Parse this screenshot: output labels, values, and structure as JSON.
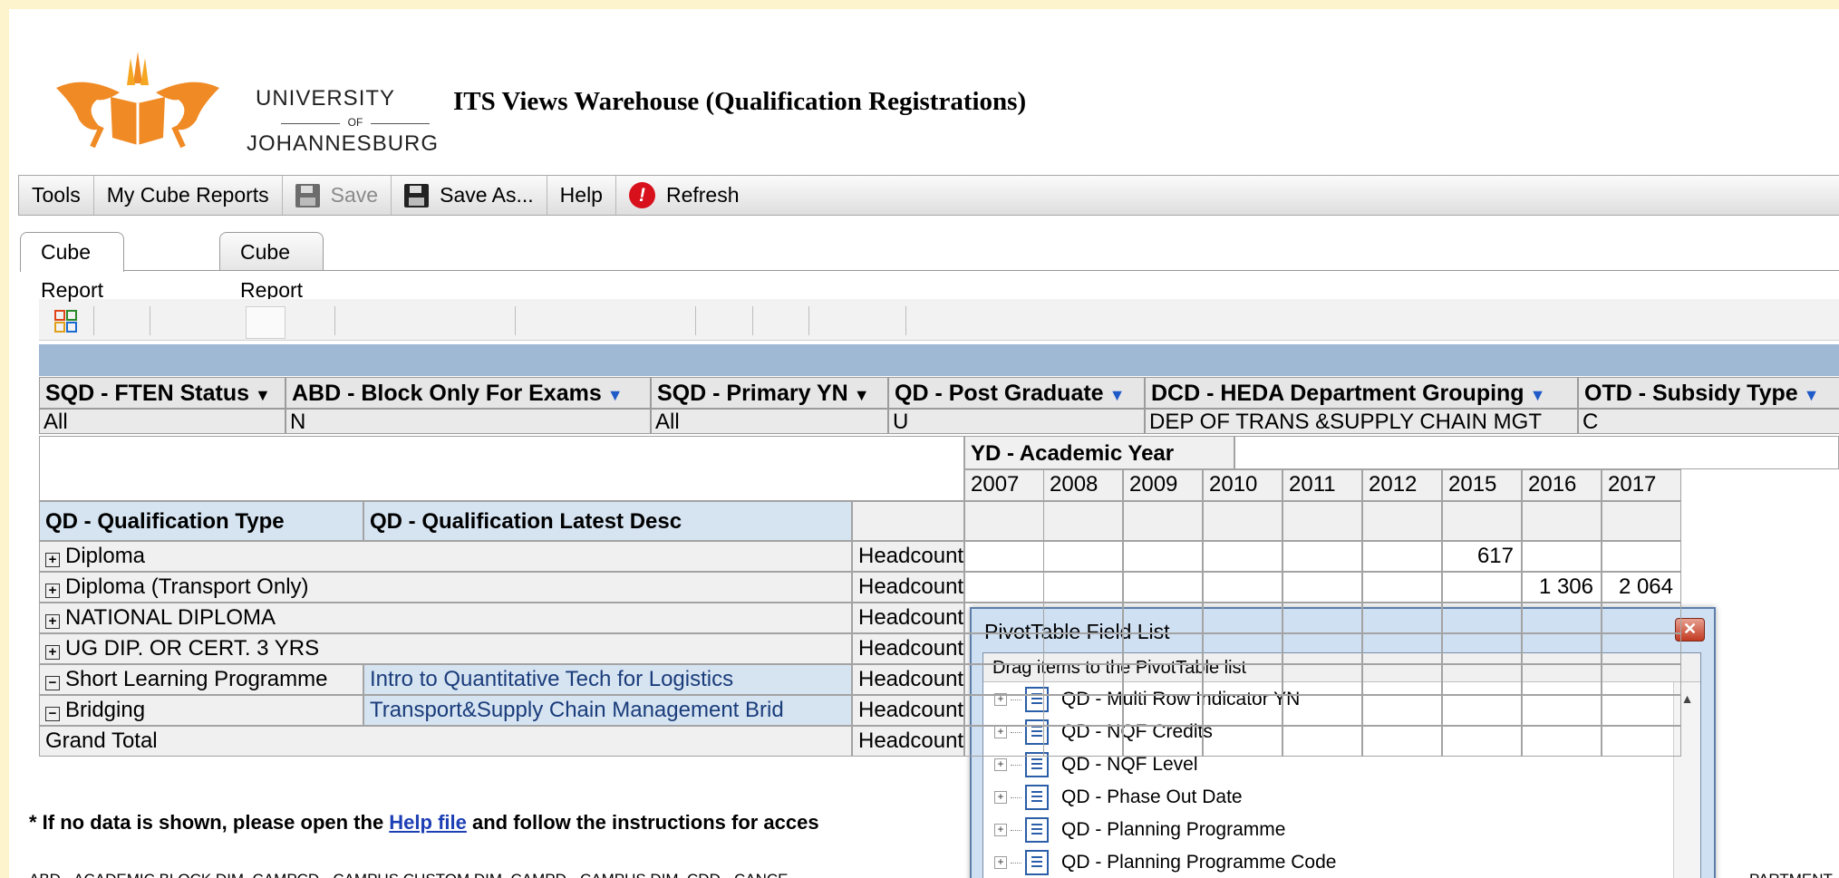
{
  "header": {
    "logo": {
      "line1": "UNIVERSITY",
      "line2": "OF",
      "line3": "JOHANNESBURG"
    },
    "title": "ITS Views Warehouse (Qualification Registrations)"
  },
  "toolbar": {
    "tools": "Tools",
    "my_reports": "My Cube Reports",
    "save": "Save",
    "save_as": "Save As...",
    "help": "Help",
    "refresh": "Refresh"
  },
  "tabs": [
    "Cube Report",
    "Cube Report Chart"
  ],
  "filters": [
    {
      "label": "SQD - FTEN Status",
      "value": "All"
    },
    {
      "label": "ABD - Block Only For Exams",
      "value": "N"
    },
    {
      "label": "SQD - Primary YN",
      "value": "All"
    },
    {
      "label": "QD - Post Graduate",
      "value": "U"
    },
    {
      "label": "DCD - HEDA Department Grouping",
      "value": "DEP OF TRANS &SUPPLY CHAIN MGT"
    },
    {
      "label": "OTD - Subsidy Type",
      "value": "C"
    }
  ],
  "pivot": {
    "col_field": "YD - Academic Year",
    "years": [
      "2007",
      "2008",
      "2009",
      "2010",
      "2011",
      "2012",
      "2015",
      "2016",
      "2017"
    ],
    "row_field1": "QD - Qualification Type",
    "row_field2": "QD - Qualification  Latest Desc",
    "expand_glyph": "⊞",
    "collapse_glyph": "⊟",
    "rows": [
      {
        "type": "Diploma",
        "desc": "",
        "measure": "Headcount",
        "values": {
          "2015": "617"
        }
      },
      {
        "type": "Diploma (Transport Only)",
        "desc": "",
        "measure": "Headcount",
        "values": {
          "2016": "1 306",
          "2017": "2 064"
        }
      },
      {
        "type": "NATIONAL DIPLOMA",
        "desc": "",
        "measure": "Headcount",
        "values": {}
      },
      {
        "type": "UG DIP. OR CERT. 3 YRS",
        "desc": "",
        "measure": "Headcount",
        "values": {}
      },
      {
        "type": "Short Learning Programme",
        "desc": "Intro to Quantitative Tech for Logistics",
        "measure": "Headcount",
        "values": {}
      },
      {
        "type": "Bridging",
        "desc": "Transport&Supply Chain Management Brid",
        "measure": "Headcount",
        "values": {}
      },
      {
        "type": "Grand Total",
        "desc": "",
        "measure": "Headcount",
        "values": {}
      }
    ]
  },
  "note": {
    "prefix": "* If no data is shown, please open the ",
    "link": "Help file",
    "suffix": " and follow the instructions for acces"
  },
  "abbreviations": "ABD - ACADEMIC BLOCK DIM, CAMPCD - CAMPUS CUSTOM DIM, CAMPD - CAMPUS DIM, CDD - CANCE",
  "abbreviations_tail": "PARTMENT",
  "field_list": {
    "title": "PivotTable Field List",
    "subtitle": "Drag items to the PivotTable list",
    "items": [
      "QD - Multi Row Indicator YN",
      "QD - NQF Credits",
      "QD - NQF Level",
      "QD - Phase Out Date",
      "QD - Planning Programme",
      "QD - Planning Programme Code"
    ]
  }
}
